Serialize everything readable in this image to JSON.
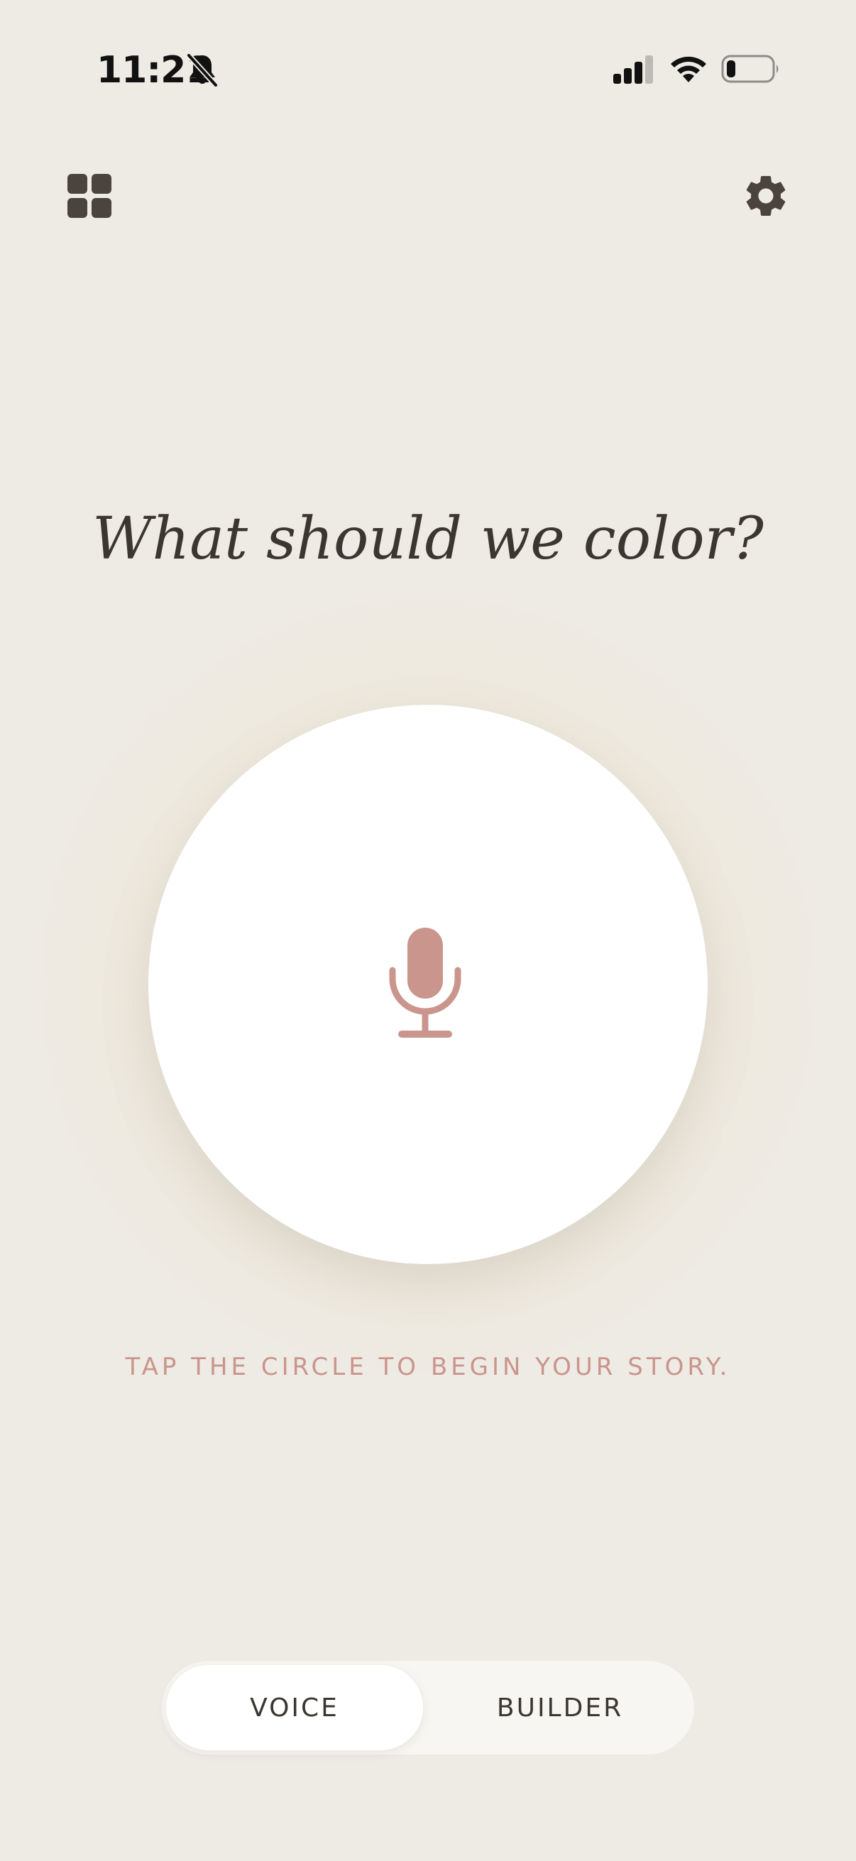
{
  "status_bar": {
    "time": "11:21",
    "battery_level": 0.2
  },
  "header": {
    "grid_icon": "grid-icon",
    "settings_icon": "gear-icon"
  },
  "main": {
    "heading": "What should we color?",
    "mic_icon": "microphone-icon",
    "hint": "TAP THE CIRCLE TO BEGIN YOUR STORY."
  },
  "mode_toggle": {
    "options": [
      {
        "label": "VOICE",
        "selected": true
      },
      {
        "label": "BUILDER",
        "selected": false
      }
    ]
  },
  "colors": {
    "background": "#EEEAE4",
    "accent": "#C9958C",
    "text": "#3C3631",
    "icon": "#4A433E"
  }
}
